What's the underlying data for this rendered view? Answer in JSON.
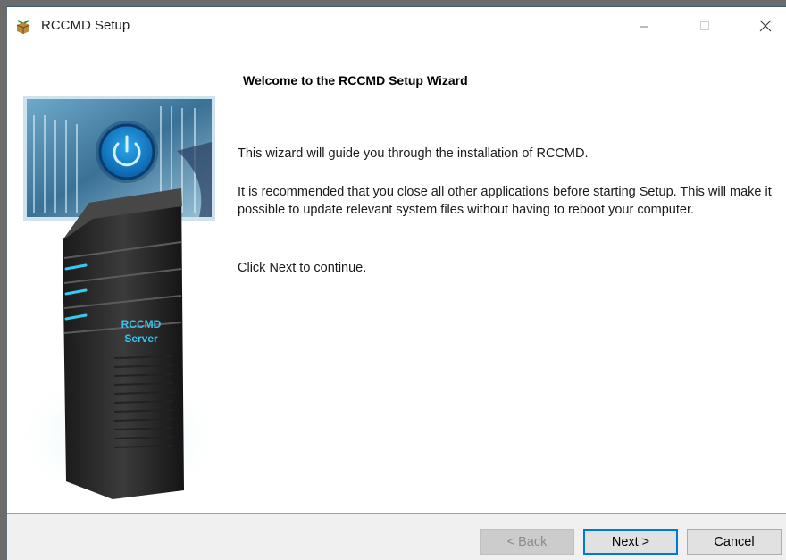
{
  "window": {
    "title": "RCCMD Setup",
    "icon": "setup-box-icon"
  },
  "banner": {
    "screen_power_icon": "power-icon",
    "server_label_line1": "RCCMD",
    "server_label_line2": "Server"
  },
  "content": {
    "heading": "Welcome to the RCCMD Setup Wizard",
    "paragraph1": "This wizard will guide you through the installation of RCCMD.",
    "paragraph2": "It is recommended that you close all other applications before starting Setup. This will make it possible to update relevant system files without having to reboot your computer.",
    "paragraph3": "Click Next to continue."
  },
  "buttons": {
    "back": "< Back",
    "next": "Next >",
    "cancel": "Cancel"
  },
  "colors": {
    "accent": "#0078d7",
    "server_label": "#35c4f0"
  }
}
